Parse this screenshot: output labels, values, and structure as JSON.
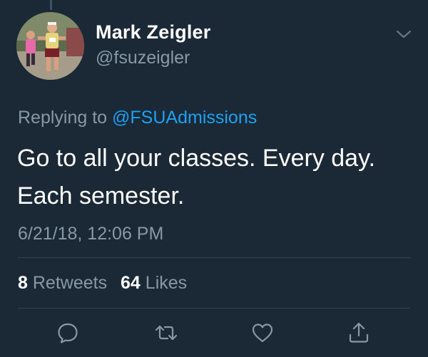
{
  "author": {
    "name": "Mark Zeigler",
    "handle": "@fsuzeigler"
  },
  "reply": {
    "prefix": "Replying to",
    "mention": "@FSUAdmissions"
  },
  "tweet": {
    "line1": "Go to all your classes. Every day.",
    "line2": "Each semester."
  },
  "timestamp": "6/21/18, 12:06 PM",
  "stats": {
    "retweets_count": "8",
    "retweets_label": "Retweets",
    "likes_count": "64",
    "likes_label": "Likes"
  },
  "icons": {
    "menu": "chevron-down-icon",
    "reply": "reply-icon",
    "retweet": "retweet-icon",
    "like": "heart-icon",
    "share": "share-icon"
  },
  "colors": {
    "background": "#1b2836",
    "text": "#ffffff",
    "secondary": "#8899a6",
    "accent": "#1da1f2",
    "divider": "#38444d"
  }
}
